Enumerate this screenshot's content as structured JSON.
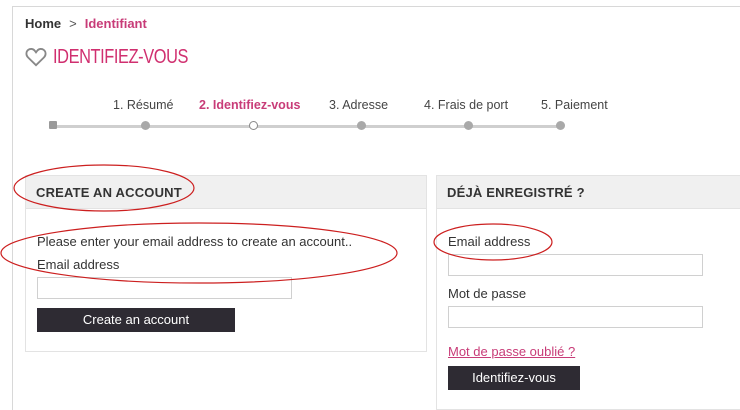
{
  "breadcrumb": {
    "home": "Home",
    "separator": ">",
    "current": "Identifiant"
  },
  "page": {
    "title": "IDENTIFIEZ-VOUS",
    "icon": "heart-outline-icon"
  },
  "steps": [
    {
      "label": "1. Résumé",
      "state": "done"
    },
    {
      "label": "2. Identifiez-vous",
      "state": "active"
    },
    {
      "label": "3. Adresse",
      "state": "todo"
    },
    {
      "label": "4. Frais de port",
      "state": "todo"
    },
    {
      "label": "5. Paiement",
      "state": "todo"
    }
  ],
  "create_account": {
    "heading": "CREATE AN ACCOUNT",
    "instructions": "Please enter your email address to create an account..",
    "email_label": "Email address",
    "email_value": "",
    "button_label": "Create an account"
  },
  "login": {
    "heading": "DÉJÀ ENREGISTRÉ ?",
    "email_label": "Email address",
    "email_value": "",
    "password_label": "Mot de passe",
    "password_value": "",
    "forgot_link": "Mot de passe oublié ?",
    "button_label": "Identifiez-vous"
  },
  "colors": {
    "accent": "#c83c78",
    "title": "#d02f6f",
    "button": "#2e2b33",
    "annotation": "#cc1f1f"
  }
}
